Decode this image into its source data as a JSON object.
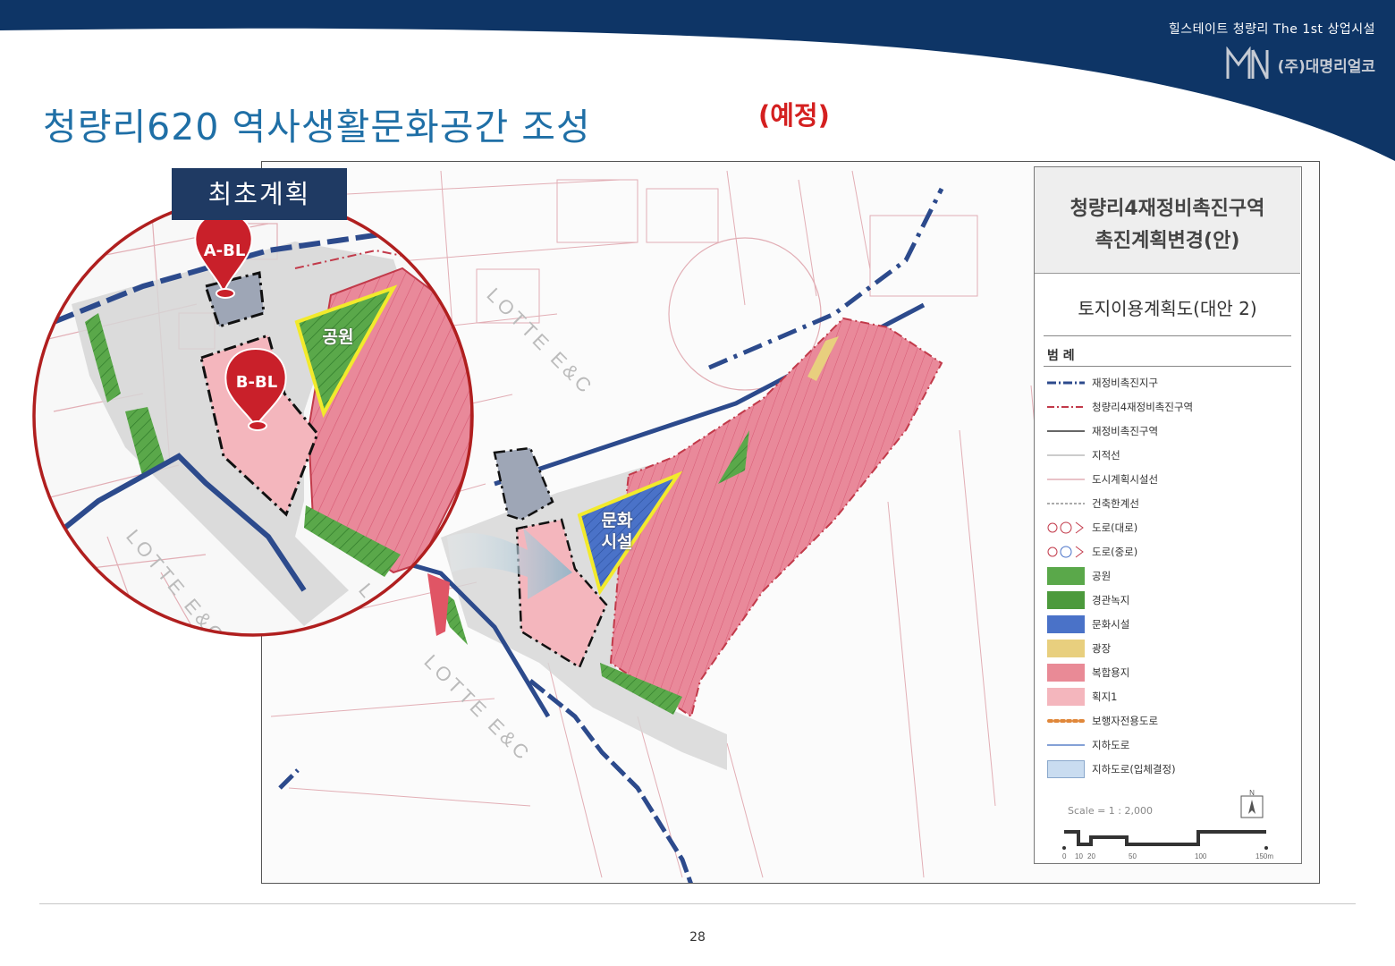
{
  "header": {
    "project_name": "힐스테이트 청량리 The 1st 상업시설",
    "brand": "(주)대명리얼코",
    "accent_color": "#0e3566"
  },
  "title": {
    "text": "청량리620 역사생활문화공간 조성",
    "badge": "(예정)"
  },
  "inset": {
    "caption": "최초계획",
    "pins": [
      "A-BL",
      "B-BL"
    ],
    "park_label": "공원",
    "border_color": "#b01f1f"
  },
  "map": {
    "culture_label_line1": "문화",
    "culture_label_line2": "시설",
    "watermark": "LOTTE E&C"
  },
  "legend": {
    "title_line1": "청량리4재정비촉진구역",
    "title_line2": "촉진계획변경(안)",
    "subtitle": "토지이용계획도(대안 2)",
    "heading": "범 례",
    "items": [
      {
        "label": "재정비촉진지구",
        "icon": "blue-dash-dot-line"
      },
      {
        "label": "청량리4재정비촉진구역",
        "icon": "red-dash-dot-line"
      },
      {
        "label": "재정비촉진구역",
        "icon": "dark-thin-line"
      },
      {
        "label": "지적선",
        "icon": "grey-thin-line"
      },
      {
        "label": "도시계획시설선",
        "icon": "red-thin-line"
      },
      {
        "label": "건축한계선",
        "icon": "dashed-line"
      },
      {
        "label": "도로(대로)",
        "icon": "road-major-symbol"
      },
      {
        "label": "도로(중로)",
        "icon": "road-medium-symbol"
      },
      {
        "label": "공원",
        "icon": "park-swatch",
        "color": "#5aa84a"
      },
      {
        "label": "경관녹지",
        "icon": "green-swatch",
        "color": "#4c9a3c"
      },
      {
        "label": "문화시설",
        "icon": "culture-swatch",
        "color": "#4a72c8"
      },
      {
        "label": "광장",
        "icon": "plaza-swatch",
        "color": "#e8cf7e"
      },
      {
        "label": "복합용지",
        "icon": "mixed-use-swatch",
        "color": "#e98a96"
      },
      {
        "label": "획지1",
        "icon": "lot-swatch",
        "color": "#f4b6bd"
      },
      {
        "label": "보행자전용도로",
        "icon": "dotted-orange-line"
      },
      {
        "label": "지하도로",
        "icon": "blue-thin-line"
      },
      {
        "label": "지하도로(입체결정)",
        "icon": "light-blue-swatch",
        "color": "#c9dcf0"
      }
    ],
    "scale": {
      "label": "Scale = 1 : 2,000",
      "ticks": [
        "0",
        "10",
        "20",
        "50",
        "100",
        "150m"
      ],
      "north": "N"
    }
  },
  "footer": {
    "page_number": "28"
  }
}
